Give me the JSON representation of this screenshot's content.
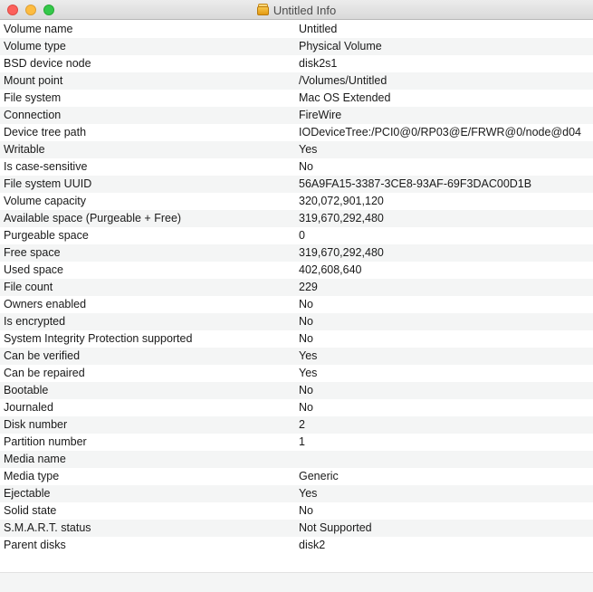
{
  "window": {
    "title": "Untitled Info"
  },
  "rows": [
    {
      "label": "Volume name",
      "value": "Untitled"
    },
    {
      "label": "Volume type",
      "value": "Physical Volume"
    },
    {
      "label": "BSD device node",
      "value": "disk2s1"
    },
    {
      "label": "Mount point",
      "value": "/Volumes/Untitled"
    },
    {
      "label": "File system",
      "value": "Mac OS Extended"
    },
    {
      "label": "Connection",
      "value": "FireWire"
    },
    {
      "label": "Device tree path",
      "value": "IODeviceTree:/PCI0@0/RP03@E/FRWR@0/node@d04"
    },
    {
      "label": "Writable",
      "value": "Yes"
    },
    {
      "label": "Is case-sensitive",
      "value": "No"
    },
    {
      "label": "File system UUID",
      "value": "56A9FA15-3387-3CE8-93AF-69F3DAC00D1B"
    },
    {
      "label": "Volume capacity",
      "value": "320,072,901,120"
    },
    {
      "label": "Available space (Purgeable + Free)",
      "value": "319,670,292,480"
    },
    {
      "label": "Purgeable space",
      "value": "0"
    },
    {
      "label": "Free space",
      "value": "319,670,292,480"
    },
    {
      "label": "Used space",
      "value": "402,608,640"
    },
    {
      "label": "File count",
      "value": "229"
    },
    {
      "label": "Owners enabled",
      "value": "No"
    },
    {
      "label": "Is encrypted",
      "value": "No"
    },
    {
      "label": "System Integrity Protection supported",
      "value": "No"
    },
    {
      "label": "Can be verified",
      "value": "Yes"
    },
    {
      "label": "Can be repaired",
      "value": "Yes"
    },
    {
      "label": "Bootable",
      "value": "No"
    },
    {
      "label": "Journaled",
      "value": "No"
    },
    {
      "label": "Disk number",
      "value": "2"
    },
    {
      "label": "Partition number",
      "value": "1"
    },
    {
      "label": "Media name",
      "value": ""
    },
    {
      "label": "Media type",
      "value": "Generic"
    },
    {
      "label": "Ejectable",
      "value": "Yes"
    },
    {
      "label": "Solid state",
      "value": "No"
    },
    {
      "label": "S.M.A.R.T. status",
      "value": "Not Supported"
    },
    {
      "label": "Parent disks",
      "value": "disk2"
    }
  ],
  "icons": {
    "close": "close-button",
    "minimize": "minimize-button",
    "zoom": "zoom-button",
    "title_icon": "external-disk-icon"
  },
  "colors": {
    "close": "#fc605b",
    "minimize": "#fdbc40",
    "zoom": "#34c84a",
    "row_stripe": "#f4f5f5"
  }
}
